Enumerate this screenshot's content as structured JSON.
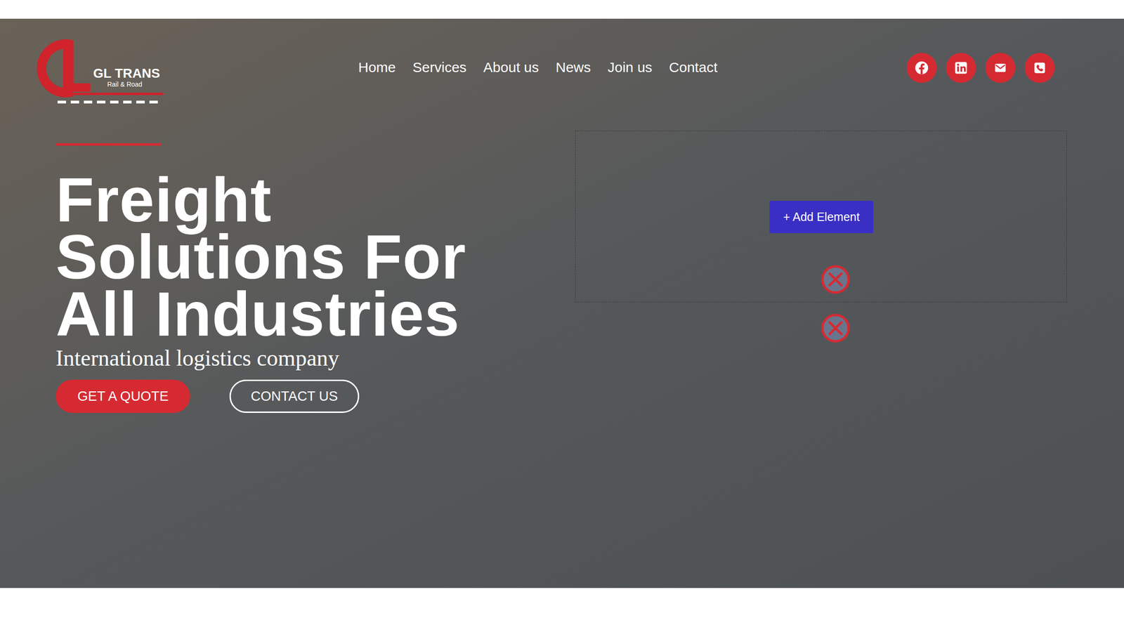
{
  "logo": {
    "name": "GL TRANS",
    "tagline": "Rail & Road"
  },
  "nav": [
    {
      "label": "Home"
    },
    {
      "label": "Services"
    },
    {
      "label": "About us"
    },
    {
      "label": "News"
    },
    {
      "label": "Join us"
    },
    {
      "label": "Contact"
    }
  ],
  "social": [
    {
      "kind": "facebook"
    },
    {
      "kind": "linkedin"
    },
    {
      "kind": "mail"
    },
    {
      "kind": "phone"
    }
  ],
  "hero": {
    "title": [
      "Freight",
      "Solutions For",
      "All Industries"
    ],
    "subtitle": "International logistics company",
    "buttons": [
      {
        "label": "GET A QUOTE",
        "kind": "primary"
      },
      {
        "label": "CONTACT US",
        "kind": "outline"
      }
    ]
  },
  "editor": {
    "add_element": "+ Add Element",
    "markers": [
      {
        "kind": "remove"
      },
      {
        "kind": "remove"
      }
    ]
  }
}
